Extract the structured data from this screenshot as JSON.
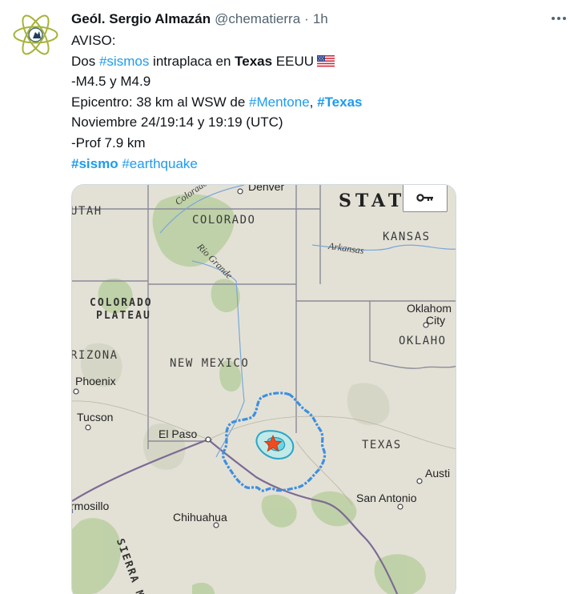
{
  "tweet": {
    "author_name": "Geól. Sergio Almazán",
    "handle": "@chematierra",
    "separator": "·",
    "time": "1h"
  },
  "text": {
    "line1": "AVISO:",
    "line2_a": "Dos ",
    "line2_tag": "#sismos",
    "line2_b": " intraplaca en ",
    "line2_bold": "Texas",
    "line2_c": " EEUU",
    "line3": "-M4.5 y M4.9",
    "line4_a": "Epicentro: 38 km al WSW de ",
    "line4_tag1": "#Mentone",
    "line4_sep": ", ",
    "line4_tag2": "#Texas",
    "line5": "Noviembre 24/19:14 y 19:19 (UTC)",
    "line6": "-Prof 7.9 km",
    "line7_tag1": "#sismo",
    "line7_tag2": "#earthquake"
  },
  "map": {
    "labels": {
      "denver": "Denver",
      "states_big": "STAT",
      "utah": "UTAH",
      "colorado": "COLORADO",
      "kansas": "KANSAS",
      "arkansas_river": "Arkansas",
      "rio_grande": "Rio Grande",
      "colorado_river": "Colorado",
      "colorado_plateau_1": "COLORADO",
      "colorado_plateau_2": "PLATEAU",
      "oklahoma_city_1": "Oklahom",
      "oklahoma_city_2": "City",
      "oklahoma": "OKLAHO",
      "arizona": "RIZONA",
      "new_mexico": "NEW MEXICO",
      "phoenix": "Phoenix",
      "tucson": "Tucson",
      "el_paso": "El Paso",
      "texas": "TEXAS",
      "austin": "Austi",
      "san_antonio": "San Antonio",
      "hermosillo": "rmosillo",
      "chihuahua": "Chihuahua",
      "sierra_madre": "SIERRA MA"
    }
  },
  "colors": {
    "link": "#1d9bf0",
    "text": "#0f1419",
    "secondary": "#536471",
    "contour": "#3d8fe0",
    "epicenter_star": "#f04a1e"
  },
  "icons": {
    "avatar": "atom-logo",
    "more": "more-dots-icon",
    "flag": "us-flag-icon",
    "key": "key-icon",
    "epicenter": "star-icon"
  }
}
